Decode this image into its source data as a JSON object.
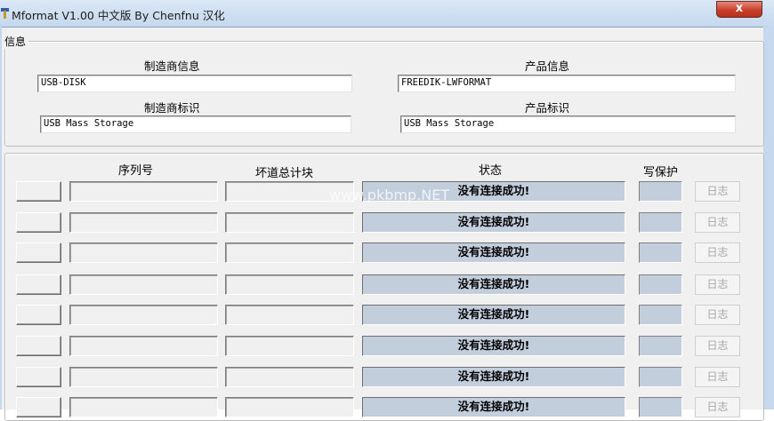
{
  "window": {
    "title": "Mformat V1.00 中文版 By Chenfnu 汉化",
    "close_label": "x"
  },
  "info_group": {
    "caption": "信息",
    "manufacturer_info_label": "制造商信息",
    "manufacturer_info_value": "USB-DISK",
    "product_info_label": "产品信息",
    "product_info_value": "FREEDIK-LWFORMAT",
    "manufacturer_id_label": "制造商标识",
    "manufacturer_id_value": "USB Mass Storage",
    "product_id_label": "产品标识",
    "product_id_value": "USB Mass Storage"
  },
  "table": {
    "headers": {
      "serial": "序列号",
      "bad_blocks": "坏道总计块",
      "status": "状态",
      "write_protect": "写保护"
    },
    "rows": [
      {
        "serial": "",
        "bad_blocks": "",
        "status": "没有连接成功!",
        "write_protect": "",
        "log": "日志"
      },
      {
        "serial": "",
        "bad_blocks": "",
        "status": "没有连接成功!",
        "write_protect": "",
        "log": "日志"
      },
      {
        "serial": "",
        "bad_blocks": "",
        "status": "没有连接成功!",
        "write_protect": "",
        "log": "日志"
      },
      {
        "serial": "",
        "bad_blocks": "",
        "status": "没有连接成功!",
        "write_protect": "",
        "log": "日志"
      },
      {
        "serial": "",
        "bad_blocks": "",
        "status": "没有连接成功!",
        "write_protect": "",
        "log": "日志"
      },
      {
        "serial": "",
        "bad_blocks": "",
        "status": "没有连接成功!",
        "write_protect": "",
        "log": "日志"
      },
      {
        "serial": "",
        "bad_blocks": "",
        "status": "没有连接成功!",
        "write_protect": "",
        "log": "日志"
      },
      {
        "serial": "",
        "bad_blocks": "",
        "status": "没有连接成功!",
        "write_protect": "",
        "log": "日志"
      }
    ]
  },
  "watermark": "www.pkbmp.NET",
  "icons": {
    "app": "app-icon",
    "close": "close-icon"
  },
  "colors": {
    "status_fill": "#c3cedd",
    "close_button": "#c8402b",
    "title_bar": "#c5d8ee"
  }
}
